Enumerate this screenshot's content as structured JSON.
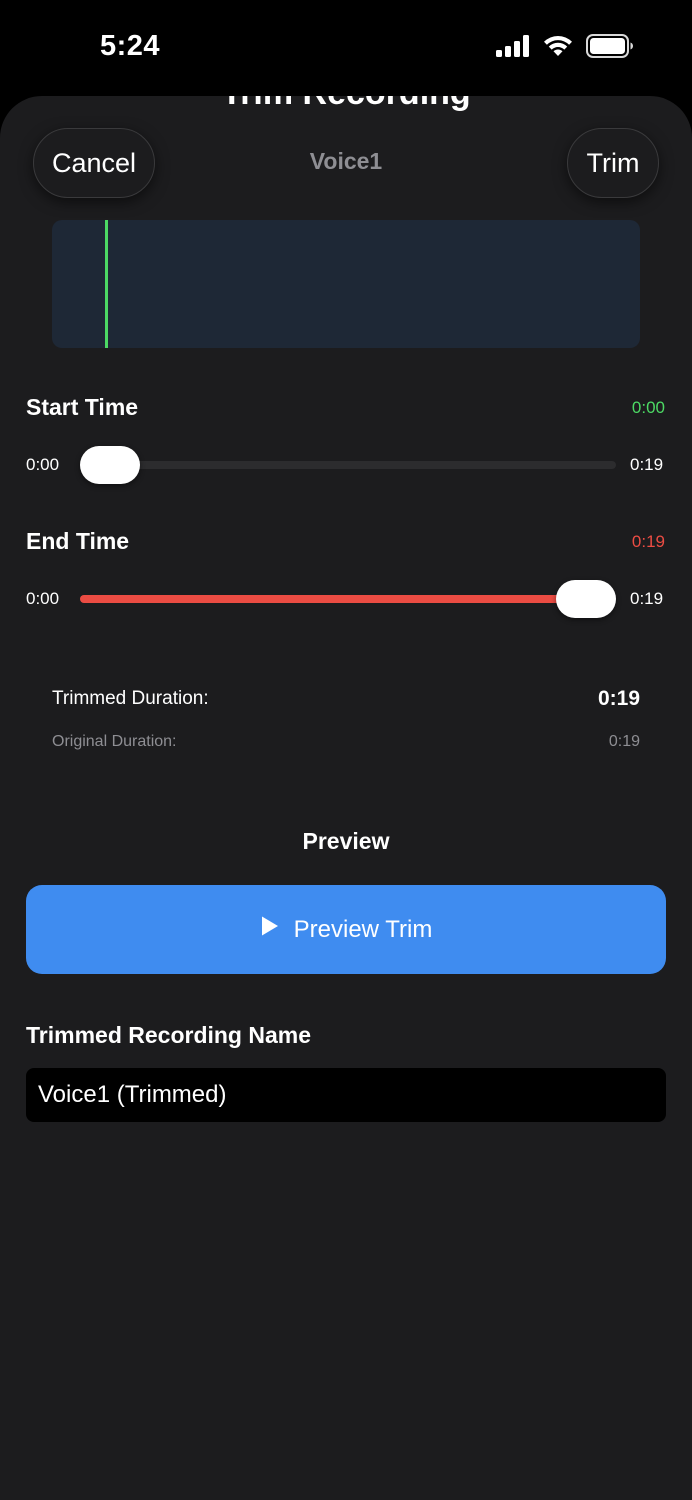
{
  "status_bar": {
    "time": "5:24",
    "icons": [
      "cellular-signal-icon",
      "wifi-icon",
      "battery-icon"
    ]
  },
  "sheet": {
    "title": "Trim Recording",
    "cancel_label": "Cancel",
    "trim_label": "Trim",
    "recording_name": "Voice1"
  },
  "waveform": {
    "playhead_position": 0.09,
    "colors": {
      "background": "#1e2836",
      "playhead": "#4cd964"
    }
  },
  "start_time": {
    "label": "Start Time",
    "value": "0:00",
    "min_label": "0:00",
    "max_label": "0:19",
    "slider_fraction": 0.0,
    "value_color": "#4cd964"
  },
  "end_time": {
    "label": "End Time",
    "value": "0:19",
    "min_label": "0:00",
    "max_label": "0:19",
    "slider_fraction": 1.0,
    "value_color": "#eb4c43"
  },
  "durations": {
    "trimmed_label": "Trimmed Duration:",
    "trimmed_value": "0:19",
    "original_label": "Original Duration:",
    "original_value": "0:19"
  },
  "preview": {
    "heading": "Preview",
    "button_label": "Preview Trim",
    "button_icon": "play-icon",
    "button_color": "#3f8cf0"
  },
  "name_field": {
    "label": "Trimmed Recording Name",
    "value": "Voice1 (Trimmed)"
  }
}
